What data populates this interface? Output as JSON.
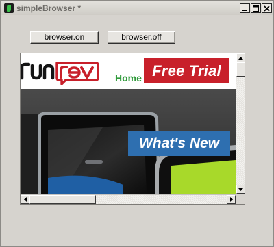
{
  "window": {
    "title": "simpleBrowser *"
  },
  "toolbar": {
    "browser_on_label": "browser.on",
    "browser_off_label": "browser.off"
  },
  "site": {
    "nav_home": "Home",
    "free_trial": "Free Trial",
    "whats_new": "What's New"
  },
  "colors": {
    "window_bg": "#d6d3ce",
    "brand_red": "#c8202a",
    "nav_green": "#2f9a3a",
    "banner_blue": "#2e6fb0"
  },
  "icons": [
    "app-icon",
    "minimize-icon",
    "maximize-icon",
    "close-icon",
    "arrow-up-icon",
    "arrow-down-icon",
    "arrow-left-icon",
    "arrow-right-icon"
  ]
}
